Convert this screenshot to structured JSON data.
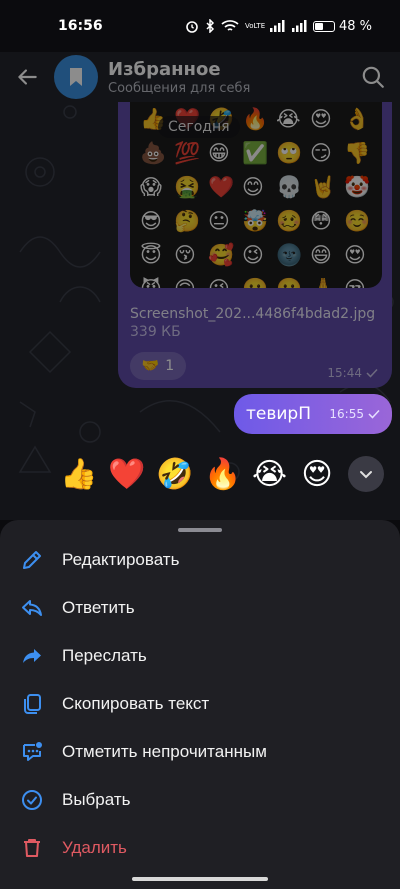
{
  "status_bar": {
    "time": "16:56",
    "network_label": "VoLTE",
    "battery_percent": "48 %",
    "battery_level": 0.48
  },
  "header": {
    "title": "Избранное",
    "subtitle": "Сообщения для себя",
    "avatar_icon": "bookmark-icon"
  },
  "chat": {
    "date_label": "Сегодня",
    "image_message": {
      "file_name": "Screenshot_202...4486f4bdad2.jpg",
      "file_size": "339 КБ",
      "reaction_emoji": "🤝",
      "reaction_count": "1",
      "time": "15:44",
      "preview_emojis": [
        "👍",
        "❤️",
        "🤣",
        "🔥",
        "😭",
        "😍",
        "👌",
        "💩",
        "💯",
        "😁",
        "✅",
        "🙄",
        "😏",
        "👎",
        "😱",
        "🤮",
        "❤️",
        "😊",
        "💀",
        "🤘",
        "🤡",
        "😎",
        "🤔",
        "😐",
        "🤯",
        "🥴",
        "😳",
        "☺️",
        "😇",
        "😚",
        "🥰",
        "😉",
        "🌚",
        "😄",
        "😍",
        "😈",
        "🙃",
        "😘",
        "🙂",
        "😬",
        "🙏",
        "😒"
      ]
    },
    "text_message": {
      "text": "тевирП",
      "time": "16:55"
    }
  },
  "reactions": [
    "👍",
    "❤️",
    "🤣",
    "🔥",
    "😭",
    "😍"
  ],
  "menu": {
    "items": [
      {
        "label": "Редактировать",
        "icon": "pencil-icon"
      },
      {
        "label": "Ответить",
        "icon": "reply-icon"
      },
      {
        "label": "Переслать",
        "icon": "forward-icon"
      },
      {
        "label": "Скопировать текст",
        "icon": "copy-icon"
      },
      {
        "label": "Отметить непрочитанным",
        "icon": "mark-unread-icon"
      },
      {
        "label": "Выбрать",
        "icon": "select-check-icon"
      },
      {
        "label": "Удалить",
        "icon": "trash-icon"
      }
    ]
  },
  "colors": {
    "accent": "#3d8ff0",
    "danger": "#e05a62",
    "sheet_bg": "#1f1f24",
    "bubble_out": "#7a5ee0"
  }
}
